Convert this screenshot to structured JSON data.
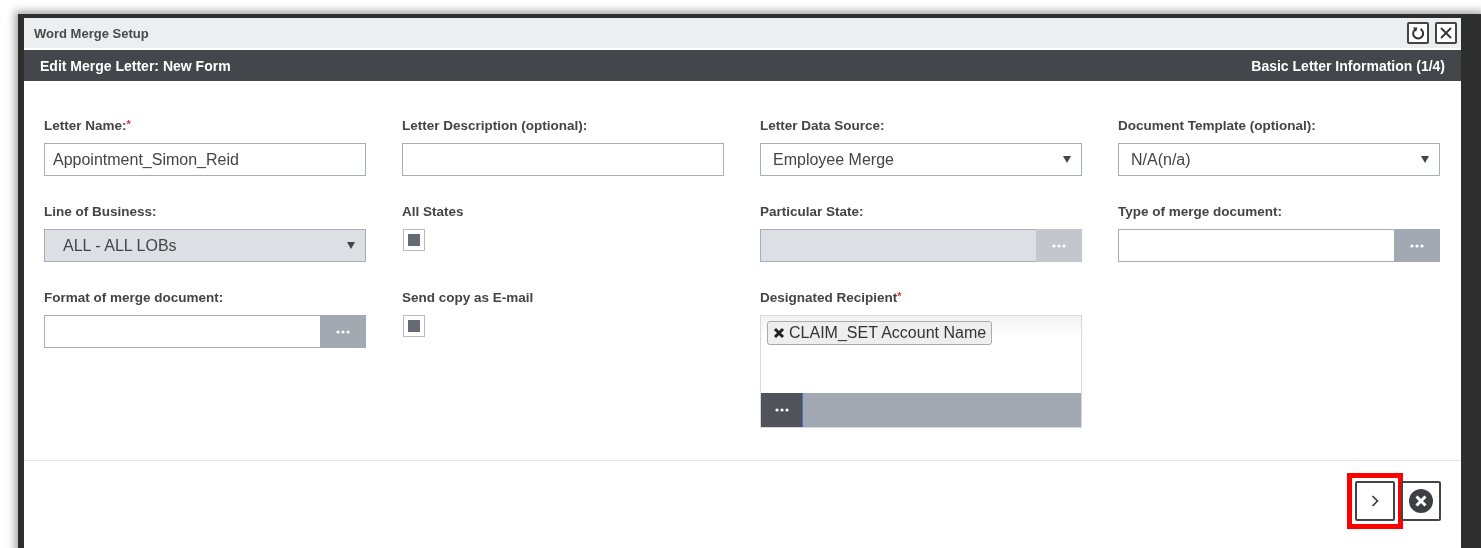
{
  "window": {
    "title": "Word Merge Setup"
  },
  "header": {
    "title": "Edit Merge Letter: New Form",
    "step": "Basic Letter Information (1/4)"
  },
  "fields": [
    {
      "kind": "text",
      "label": "Letter Name:",
      "mark": "*",
      "value": "Appointment_Simon_Reid"
    },
    {
      "kind": "text",
      "label": "Letter Description (optional):"
    },
    {
      "kind": "select",
      "label": "Letter Data Source:",
      "value": "Employee Merge",
      "disabled": false
    },
    {
      "kind": "select",
      "label": "Document Template (optional):",
      "value": "N/A(n/a)",
      "disabled": false
    },
    {
      "kind": "select",
      "label": "Line of Business:",
      "value": "ALL - ALL LOBs",
      "disabled": true
    },
    {
      "kind": "checkbox",
      "label": "All States",
      "checked": true
    },
    {
      "kind": "lookup",
      "label": "Particular State:",
      "disabled": true
    },
    {
      "kind": "lookup",
      "label": "Type of merge document:",
      "disabled": false
    },
    {
      "kind": "lookup",
      "label": "Format of merge document:",
      "disabled": false
    },
    {
      "kind": "checkbox",
      "label": "Send copy as E-mail",
      "checked": true
    },
    {
      "kind": "tags",
      "label": "Designated Recipient",
      "mark": "*",
      "tags": [
        "CLAIM_SET Account Name"
      ]
    }
  ],
  "footer": {
    "buttons": [
      {
        "kind": "next",
        "highlighted": true
      },
      {
        "kind": "cancel",
        "highlighted": false
      }
    ]
  }
}
